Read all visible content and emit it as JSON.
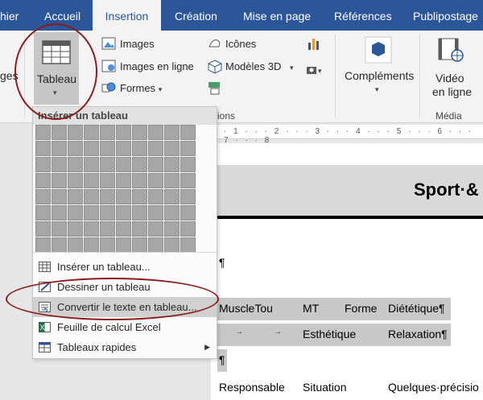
{
  "tabs": [
    {
      "label": "hier"
    },
    {
      "label": "Accueil"
    },
    {
      "label": "Insertion"
    },
    {
      "label": "Création"
    },
    {
      "label": "Mise en page"
    },
    {
      "label": "Références"
    },
    {
      "label": "Publipostage"
    }
  ],
  "ribbon": {
    "ages_fragment": "ges",
    "tableau_label": "Tableau",
    "images": "Images",
    "images_online": "Images en ligne",
    "formes": "Formes",
    "icones": "Icônes",
    "modeles3d": "Modèles 3D",
    "group_illustrations_fragment": "ions",
    "complements": "Compléments",
    "video_line1": "Vidéo",
    "video_line2": "en ligne",
    "group_media": "Média"
  },
  "dropdown": {
    "header": "Insérer un tableau",
    "items": [
      {
        "label": "Insérer un tableau..."
      },
      {
        "label": "Dessiner un tableau"
      },
      {
        "label": "Convertir le texte en tableau..."
      },
      {
        "label": "Feuille de calcul Excel"
      },
      {
        "label": "Tableaux rapides"
      }
    ]
  },
  "ruler": {
    "marks": "· 1 · · · 2 · · · 3 · · · 4 · · · 5 · · · 6 · · · 7 · · · 8"
  },
  "document": {
    "title_fragment": "Sport·&",
    "para1": "¶",
    "row1": {
      "c1": "MuscleTou",
      "c2": "MT",
      "c3": "Forme",
      "c4": "Diététique¶"
    },
    "row2": {
      "c1": "→",
      "c2": "→",
      "c3": "Esthétique",
      "c4": "Relaxation¶"
    },
    "row3_fragment": "¶",
    "row4": {
      "c1": "Responsable",
      "c2": "Situation",
      "c3": "Quelques·précisio"
    }
  },
  "colors": {
    "accent": "#2b579a",
    "annotation": "#8c1c1c"
  }
}
